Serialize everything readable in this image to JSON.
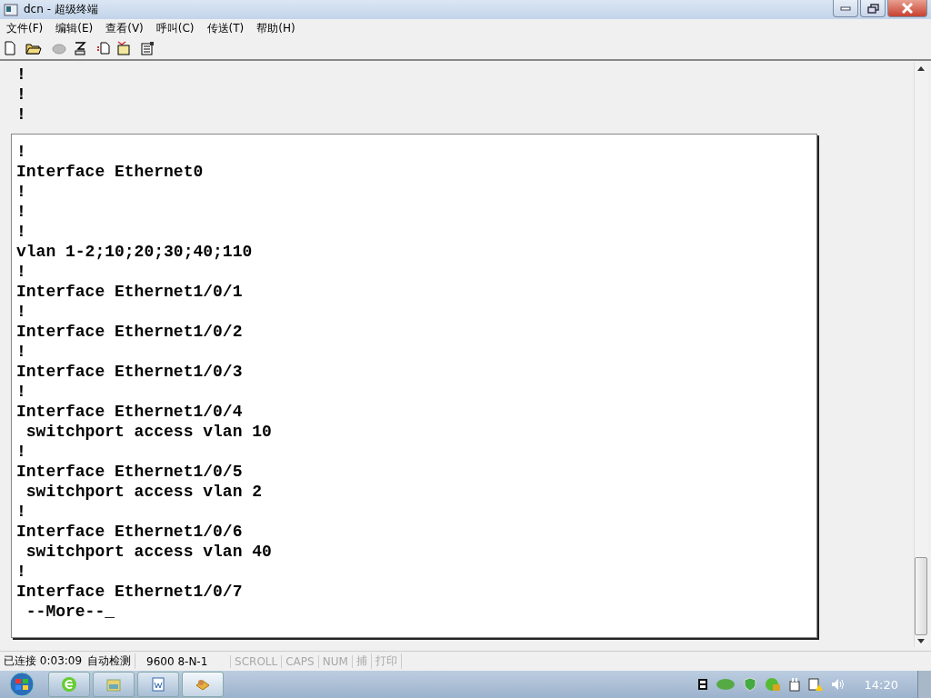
{
  "window": {
    "title": "dcn - 超级终端"
  },
  "menu": [
    "文件(F)",
    "编辑(E)",
    "查看(V)",
    "呼叫(C)",
    "传送(T)",
    "帮助(H)"
  ],
  "terminal": {
    "history_lines": [
      "!",
      "!",
      "!"
    ],
    "lines": [
      "!",
      "Interface Ethernet0",
      "!",
      "!",
      "!",
      "vlan 1-2;10;20;30;40;110",
      "!",
      "Interface Ethernet1/0/1",
      "!",
      "Interface Ethernet1/0/2",
      "!",
      "Interface Ethernet1/0/3",
      "!",
      "Interface Ethernet1/0/4",
      " switchport access vlan 10",
      "!",
      "Interface Ethernet1/0/5",
      " switchport access vlan 2",
      "!",
      "Interface Ethernet1/0/6",
      " switchport access vlan 40",
      "!",
      "Interface Ethernet1/0/7",
      " --More--_"
    ]
  },
  "status_bar": [
    {
      "text": "已连接 0:03:09",
      "disabled": false
    },
    {
      "text": "自动检测",
      "disabled": false
    },
    {
      "text": "9600 8-N-1",
      "disabled": false
    },
    {
      "text": "SCROLL",
      "disabled": true
    },
    {
      "text": "CAPS",
      "disabled": true
    },
    {
      "text": "NUM",
      "disabled": true
    },
    {
      "text": "捕",
      "disabled": true
    },
    {
      "text": "打印",
      "disabled": true
    }
  ],
  "taskbar": {
    "clock": "14:20"
  }
}
